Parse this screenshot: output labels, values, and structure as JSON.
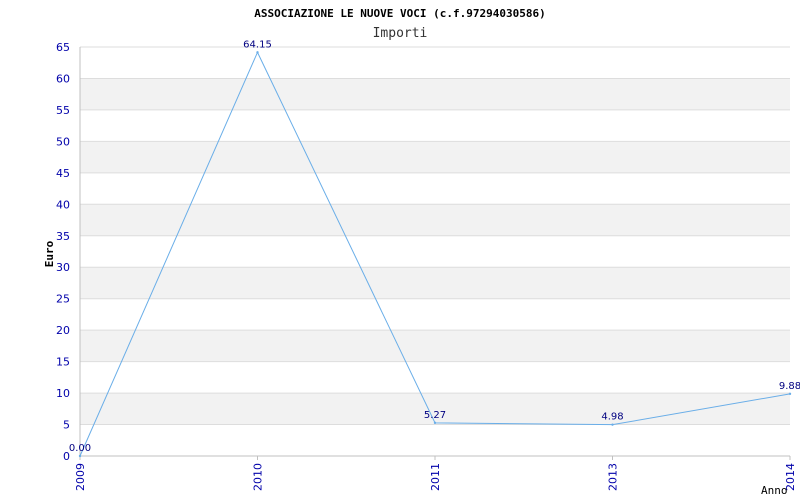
{
  "chart_data": {
    "type": "line",
    "title": "ASSOCIAZIONE LE NUOVE VOCI (c.f.97294030586)",
    "subtitle": "Importi",
    "xlabel": "Anno",
    "ylabel": "Euro",
    "categories": [
      "2009",
      "2010",
      "2011",
      "2013",
      "2014"
    ],
    "series": [
      {
        "values": [
          0.0,
          64.15,
          5.27,
          4.98,
          9.88
        ],
        "labels": [
          "0.00",
          "64.15",
          "5.27",
          "4.98",
          "9.88"
        ]
      }
    ],
    "ylim": [
      0,
      65
    ],
    "yticks": [
      "0",
      "5",
      "10",
      "15",
      "20",
      "25",
      "30",
      "35",
      "40",
      "45",
      "50",
      "55",
      "60",
      "65"
    ],
    "grid": true,
    "line_color": "#6aaee8",
    "band_color": "#f2f2f2",
    "tick_color": "#0000aa"
  }
}
